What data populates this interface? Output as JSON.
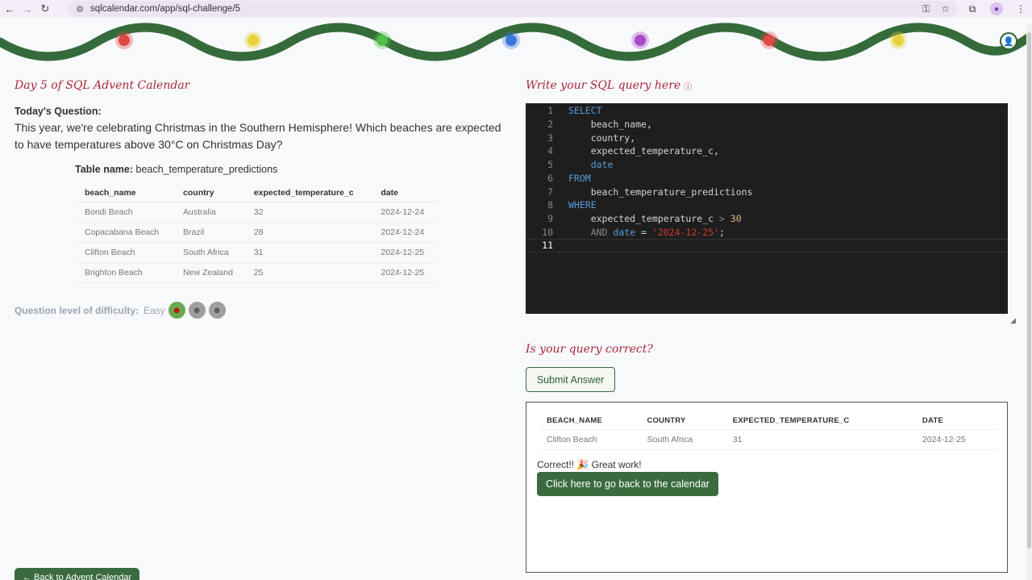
{
  "browser": {
    "url": "sqlcalendar.com/app/sql-challenge/5",
    "back_icon": "arrow-left-icon",
    "forward_icon": "arrow-right-icon",
    "reload_icon": "reload-icon"
  },
  "garland": {
    "bulb_colors": [
      "#e04848",
      "#e8d23a",
      "#4fbf4a",
      "#3c78d8",
      "#a64cc9",
      "#e04848",
      "#e8d23a"
    ],
    "wire_color": "#356b3a"
  },
  "left": {
    "day_title": "Day 5 of SQL Advent Calendar",
    "question_label": "Today's Question:",
    "question_text": "This year, we're celebrating Christmas in the Southern Hemisphere! Which beaches are expected to have temperatures above 30°C on Christmas Day?",
    "table_name_label": "Table name:",
    "table_name": "beach_temperature_predictions",
    "table": {
      "headers": [
        "beach_name",
        "country",
        "expected_temperature_c",
        "date"
      ],
      "rows": [
        [
          "Bondi Beach",
          "Australia",
          "32",
          "2024-12-24"
        ],
        [
          "Copacabana Beach",
          "Brazil",
          "28",
          "2024-12-24"
        ],
        [
          "Clifton Beach",
          "South Africa",
          "31",
          "2024-12-25"
        ],
        [
          "Brighton Beach",
          "New Zealand",
          "25",
          "2024-12-25"
        ]
      ]
    },
    "difficulty_label": "Question level of difficulty:",
    "difficulty_value": "Easy",
    "back_button": "← Back to Advent Calendar"
  },
  "right": {
    "sql_title": "Write your SQL query here",
    "line_numbers": [
      "1",
      "2",
      "3",
      "4",
      "5",
      "6",
      "7",
      "8",
      "9",
      "10",
      "11"
    ],
    "correct_title": "Is your query correct?",
    "submit_label": "Submit Answer",
    "result": {
      "headers": [
        "BEACH_NAME",
        "COUNTRY",
        "EXPECTED_TEMPERATURE_C",
        "DATE"
      ],
      "rows": [
        [
          "Clifton Beach",
          "South Africa",
          "31",
          "2024-12-25"
        ]
      ]
    },
    "correct_message": "Correct!! 🎉 Great work!",
    "calendar_button": "Click here to go back to the calendar"
  },
  "code": {
    "l1": "SELECT",
    "l2": "    beach_name,",
    "l3": "    country,",
    "l4": "    expected_temperature_c,",
    "l5_kw": "date",
    "l6": "FROM",
    "l7": "    beach_temperature_predictions",
    "l8": "WHERE",
    "l9_a": "    expected_temperature_c ",
    "l9_op": ">",
    "l9_num": " 30",
    "l10_and": "AND",
    "l10_date": "date",
    "l10_eq": " = ",
    "l10_str": "'2024-12-25'",
    "l10_semi": ";"
  }
}
